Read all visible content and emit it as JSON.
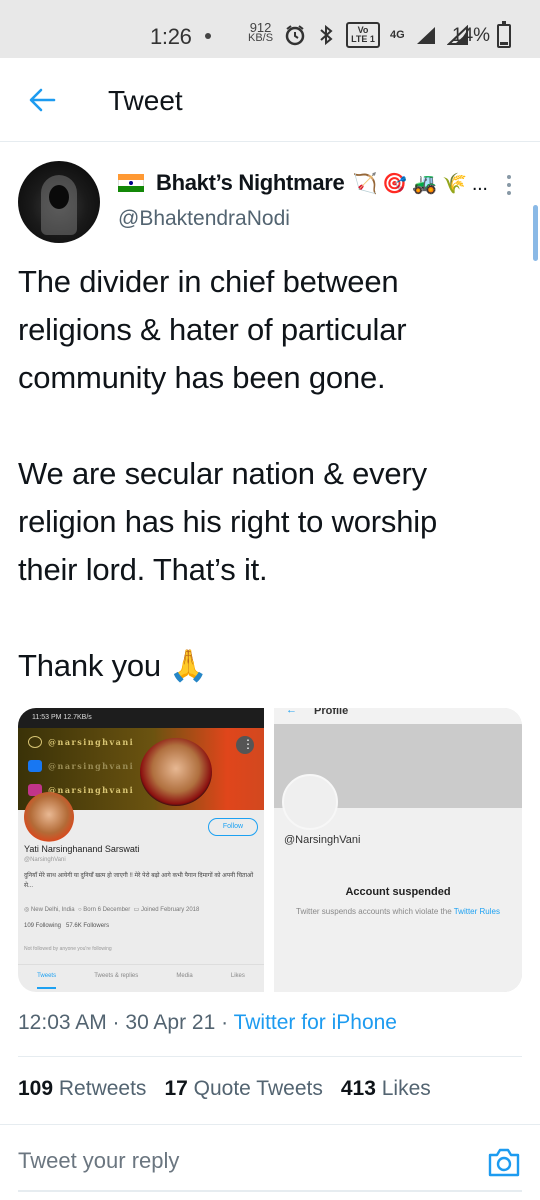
{
  "status_bar": {
    "time": "1:26",
    "net_speed_value": "912",
    "net_speed_unit": "KB/S",
    "volte_label": "Vo LTE 1",
    "network_label": "4G",
    "battery_percent": "14%"
  },
  "header": {
    "title": "Tweet"
  },
  "author": {
    "name": "Bhakt’s Nightmare",
    "name_emojis": "🏹 🎯 🚜 🌾 ...",
    "handle": "@BhaktendraNodi"
  },
  "tweet": {
    "paragraphs": [
      [
        "The divider in chief between",
        "religions & hater of particular",
        "community has been gone."
      ],
      [
        "We are secular nation & every",
        "religion has his right to worship",
        "their lord. That’s it."
      ],
      [
        "Thank you 🙏"
      ]
    ]
  },
  "media": {
    "left": {
      "statusbar": "11:53 PM 12.7KB/s",
      "banner_lines": [
        "@narsinghvani",
        "@narsinghvani",
        "@narsinghvani"
      ],
      "follow_label": "Follow",
      "name": "Yati Narsinghanand Sarswati",
      "handle": "@NarsinghVani",
      "bio": "दुनियाँ मेरे साथ आयेगी या दुनियाँ खत्म हो जाएगी !! मेरे पेरो बढ़ो आगे कभी पैगान दिमागों को अपनी चिताओं से...",
      "location": "New Delhi, India",
      "born": "Born 6 December",
      "joined": "Joined February 2018",
      "following": "109 Following",
      "followers": "57.6K Followers",
      "not_followed": "Not followed by anyone you're following",
      "tabs": [
        "Tweets",
        "Tweets & replies",
        "Media",
        "Likes"
      ]
    },
    "right": {
      "top_title": "Profile",
      "handle": "@NarsinghVani",
      "suspended_title": "Account suspended",
      "suspended_text": "Twitter suspends accounts which violate the ",
      "rules_link": "Twitter Rules"
    }
  },
  "meta": {
    "time_date": "12:03 AM · 30 Apr 21 · ",
    "source": "Twitter for iPhone"
  },
  "stats": {
    "retweets_count": "109",
    "retweets_label": "Retweets",
    "quotes_count": "17",
    "quotes_label": "Quote Tweets",
    "likes_count": "413",
    "likes_label": "Likes"
  },
  "reply": {
    "placeholder": "Tweet your reply"
  },
  "colors": {
    "accent": "#1d9bf0",
    "text": "#0f1419",
    "secondary": "#536471"
  }
}
